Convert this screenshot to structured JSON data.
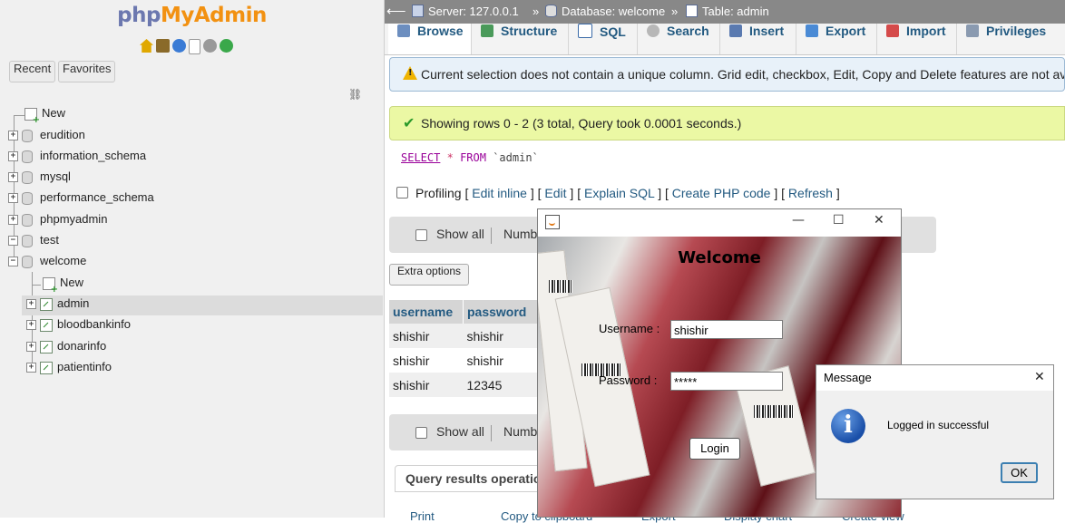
{
  "nav": {
    "logo_php": "php",
    "logo_my": "MyAdmin",
    "icons": [
      "home-icon",
      "logout-icon",
      "help-icon",
      "docs-icon",
      "settings-icon",
      "reload-icon"
    ],
    "recent_label": "Recent",
    "favorites_label": "Favorites",
    "tree": [
      {
        "label": "New",
        "type": "new"
      },
      {
        "label": "erudition",
        "type": "db"
      },
      {
        "label": "information_schema",
        "type": "db"
      },
      {
        "label": "mysql",
        "type": "db"
      },
      {
        "label": "performance_schema",
        "type": "db"
      },
      {
        "label": "phpmyadmin",
        "type": "db"
      },
      {
        "label": "test",
        "type": "db"
      },
      {
        "label": "welcome",
        "type": "db",
        "expanded": true
      },
      {
        "label": "New",
        "type": "new"
      },
      {
        "label": "admin",
        "type": "table",
        "selected": true
      },
      {
        "label": "bloodbankinfo",
        "type": "table"
      },
      {
        "label": "donarinfo",
        "type": "table"
      },
      {
        "label": "patientinfo",
        "type": "table"
      }
    ]
  },
  "breadcrumb": {
    "server": "Server: 127.0.0.1",
    "database": "Database: welcome",
    "table": "Table: admin"
  },
  "tabs": [
    "Browse",
    "Structure",
    "SQL",
    "Search",
    "Insert",
    "Export",
    "Import",
    "Privileges"
  ],
  "notices": {
    "warning": "Current selection does not contain a unique column. Grid edit, checkbox, Edit, Copy and Delete features are not available.",
    "success": "Showing rows 0 - 2 (3 total, Query took 0.0001 seconds.)"
  },
  "sql": {
    "select": "SELECT",
    "star": "*",
    "from": "FROM",
    "table": "`admin`"
  },
  "profiling": {
    "label": "Profiling",
    "links": [
      "Edit inline",
      "Edit",
      "Explain SQL",
      "Create PHP code",
      "Refresh"
    ]
  },
  "controls": {
    "show_all": "Show all",
    "number_truncated": "Numbe",
    "extra_options": "Extra options",
    "query_results_ops": "Query results operations",
    "bottom_links": [
      "Print",
      "Copy to clipboard",
      "Export",
      "Display chart",
      "Create view"
    ]
  },
  "table": {
    "columns": [
      "username",
      "password"
    ],
    "rows": [
      [
        "shishir",
        "shishir"
      ],
      [
        "shishir",
        "shishir"
      ],
      [
        "shishir",
        "12345"
      ]
    ]
  },
  "login_window": {
    "title": "",
    "heading": "Welcome",
    "username_label": "Username :",
    "username_value": "shishir",
    "password_label": "Password :",
    "password_value": "*****",
    "login_button": "Login"
  },
  "message_dialog": {
    "title": "Message",
    "text": "Logged in successful",
    "ok_button": "OK"
  },
  "colors": {
    "link": "#235a81",
    "warning_bg": "#e8f1f9",
    "success_bg": "#ebf8a4",
    "topbar_bg": "#888888"
  }
}
